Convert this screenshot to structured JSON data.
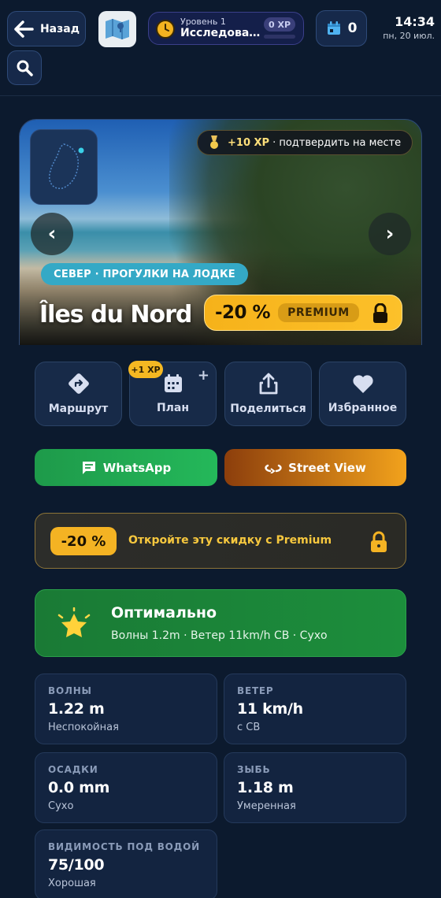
{
  "topbar": {
    "back_label": "Назад",
    "level": {
      "subtitle": "Уровень 1",
      "title": "Исследова...",
      "xp": "0 XP",
      "progress": 0
    },
    "calendar_count": "0",
    "time": "14:34",
    "date": "пн, 20 июл."
  },
  "hero": {
    "xp_badge": {
      "value": "+10 XP",
      "text": "· подтвердить на месте"
    },
    "tagline": "СЕВЕР · ПРОГУЛКИ НА ЛОДКЕ",
    "title": "Îles du Nord",
    "discount": "-20 %",
    "premium_label": "PREMIUM"
  },
  "actions": [
    {
      "label": "Маршрут",
      "icon": "route-icon"
    },
    {
      "label": "План",
      "icon": "calendar-icon",
      "badge": "+1 XP"
    },
    {
      "label": "Поделиться",
      "icon": "share-icon"
    },
    {
      "label": "Избранное",
      "icon": "heart-icon"
    }
  ],
  "buttons": {
    "whatsapp": "WhatsApp",
    "street_view": "Street View"
  },
  "promo": {
    "discount": "-20 %",
    "text": "Откройте эту скидку с Premium"
  },
  "conditions": {
    "title": "Оптимально",
    "summary": "Волны 1.2m · Ветер 11km/h СВ · Сухо"
  },
  "stats": [
    {
      "label": "ВОЛНЫ",
      "value": "1.22 m",
      "sub": "Неспокойная"
    },
    {
      "label": "ВЕТЕР",
      "value": "11 km/h",
      "sub": "с СВ"
    },
    {
      "label": "ОСАДКИ",
      "value": "0.0 mm",
      "sub": "Сухо"
    },
    {
      "label": "ЗЫБЬ",
      "value": "1.18 m",
      "sub": "Умеренная"
    },
    {
      "label": "ВИДИМОСТЬ ПОД ВОДОЙ",
      "value": "75/100",
      "sub": "Хорошая"
    }
  ],
  "colors": {
    "background": "#0c1a2e",
    "accent_gold": "#f5b822",
    "good_green": "#1c8e3c",
    "whatsapp_green": "#24b85a",
    "teal_tag": "#34a9c6"
  }
}
